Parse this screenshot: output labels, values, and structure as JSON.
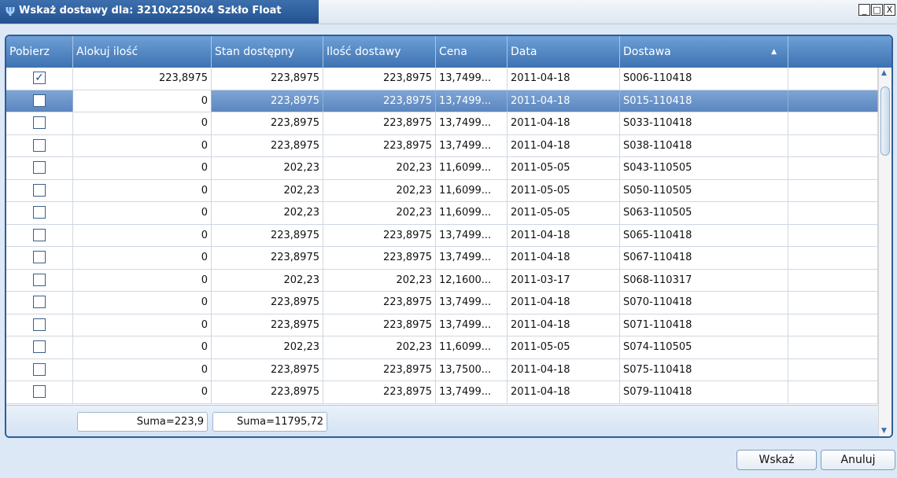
{
  "window": {
    "title": "Wskaż dostawy dla: 3210x2250x4 Szkło Float",
    "minimize": "_",
    "maximize": "□",
    "close": "X"
  },
  "grid": {
    "headers": [
      "Pobierz",
      "Alokuj ilość",
      "Stan dostępny",
      "Ilość dostawy",
      "Cena",
      "Data",
      "Dostawa",
      ""
    ],
    "sort_indicator": "▲",
    "rows": [
      {
        "checked": true,
        "alokuj": "223,8975",
        "stan": "223,8975",
        "ilosc": "223,8975",
        "cena": "13,7499...",
        "data": "2011-04-18",
        "dostawa": "S006-110418"
      },
      {
        "checked": false,
        "alokuj": "0",
        "stan": "223,8975",
        "ilosc": "223,8975",
        "cena": "13,7499...",
        "data": "2011-04-18",
        "dostawa": "S015-110418"
      },
      {
        "checked": false,
        "alokuj": "0",
        "stan": "223,8975",
        "ilosc": "223,8975",
        "cena": "13,7499...",
        "data": "2011-04-18",
        "dostawa": "S033-110418"
      },
      {
        "checked": false,
        "alokuj": "0",
        "stan": "223,8975",
        "ilosc": "223,8975",
        "cena": "13,7499...",
        "data": "2011-04-18",
        "dostawa": "S038-110418"
      },
      {
        "checked": false,
        "alokuj": "0",
        "stan": "202,23",
        "ilosc": "202,23",
        "cena": "11,6099...",
        "data": "2011-05-05",
        "dostawa": "S043-110505"
      },
      {
        "checked": false,
        "alokuj": "0",
        "stan": "202,23",
        "ilosc": "202,23",
        "cena": "11,6099...",
        "data": "2011-05-05",
        "dostawa": "S050-110505"
      },
      {
        "checked": false,
        "alokuj": "0",
        "stan": "202,23",
        "ilosc": "202,23",
        "cena": "11,6099...",
        "data": "2011-05-05",
        "dostawa": "S063-110505"
      },
      {
        "checked": false,
        "alokuj": "0",
        "stan": "223,8975",
        "ilosc": "223,8975",
        "cena": "13,7499...",
        "data": "2011-04-18",
        "dostawa": "S065-110418"
      },
      {
        "checked": false,
        "alokuj": "0",
        "stan": "223,8975",
        "ilosc": "223,8975",
        "cena": "13,7499...",
        "data": "2011-04-18",
        "dostawa": "S067-110418"
      },
      {
        "checked": false,
        "alokuj": "0",
        "stan": "202,23",
        "ilosc": "202,23",
        "cena": "12,1600...",
        "data": "2011-03-17",
        "dostawa": "S068-110317"
      },
      {
        "checked": false,
        "alokuj": "0",
        "stan": "223,8975",
        "ilosc": "223,8975",
        "cena": "13,7499...",
        "data": "2011-04-18",
        "dostawa": "S070-110418"
      },
      {
        "checked": false,
        "alokuj": "0",
        "stan": "223,8975",
        "ilosc": "223,8975",
        "cena": "13,7499...",
        "data": "2011-04-18",
        "dostawa": "S071-110418"
      },
      {
        "checked": false,
        "alokuj": "0",
        "stan": "202,23",
        "ilosc": "202,23",
        "cena": "11,6099...",
        "data": "2011-05-05",
        "dostawa": "S074-110505"
      },
      {
        "checked": false,
        "alokuj": "0",
        "stan": "223,8975",
        "ilosc": "223,8975",
        "cena": "13,7500...",
        "data": "2011-04-18",
        "dostawa": "S075-110418"
      },
      {
        "checked": false,
        "alokuj": "0",
        "stan": "223,8975",
        "ilosc": "223,8975",
        "cena": "13,7499...",
        "data": "2011-04-18",
        "dostawa": "S079-110418"
      }
    ],
    "selected_row": 1,
    "footer": {
      "sum_alokuj": "Suma=223,9",
      "sum_stan": "Suma=11795,72"
    }
  },
  "buttons": {
    "ok": "Wskaż",
    "cancel": "Anuluj"
  },
  "colors": {
    "title_bg": "#24528f",
    "header_bg": "#3e72b2",
    "selected_row": "#5b86bf"
  }
}
